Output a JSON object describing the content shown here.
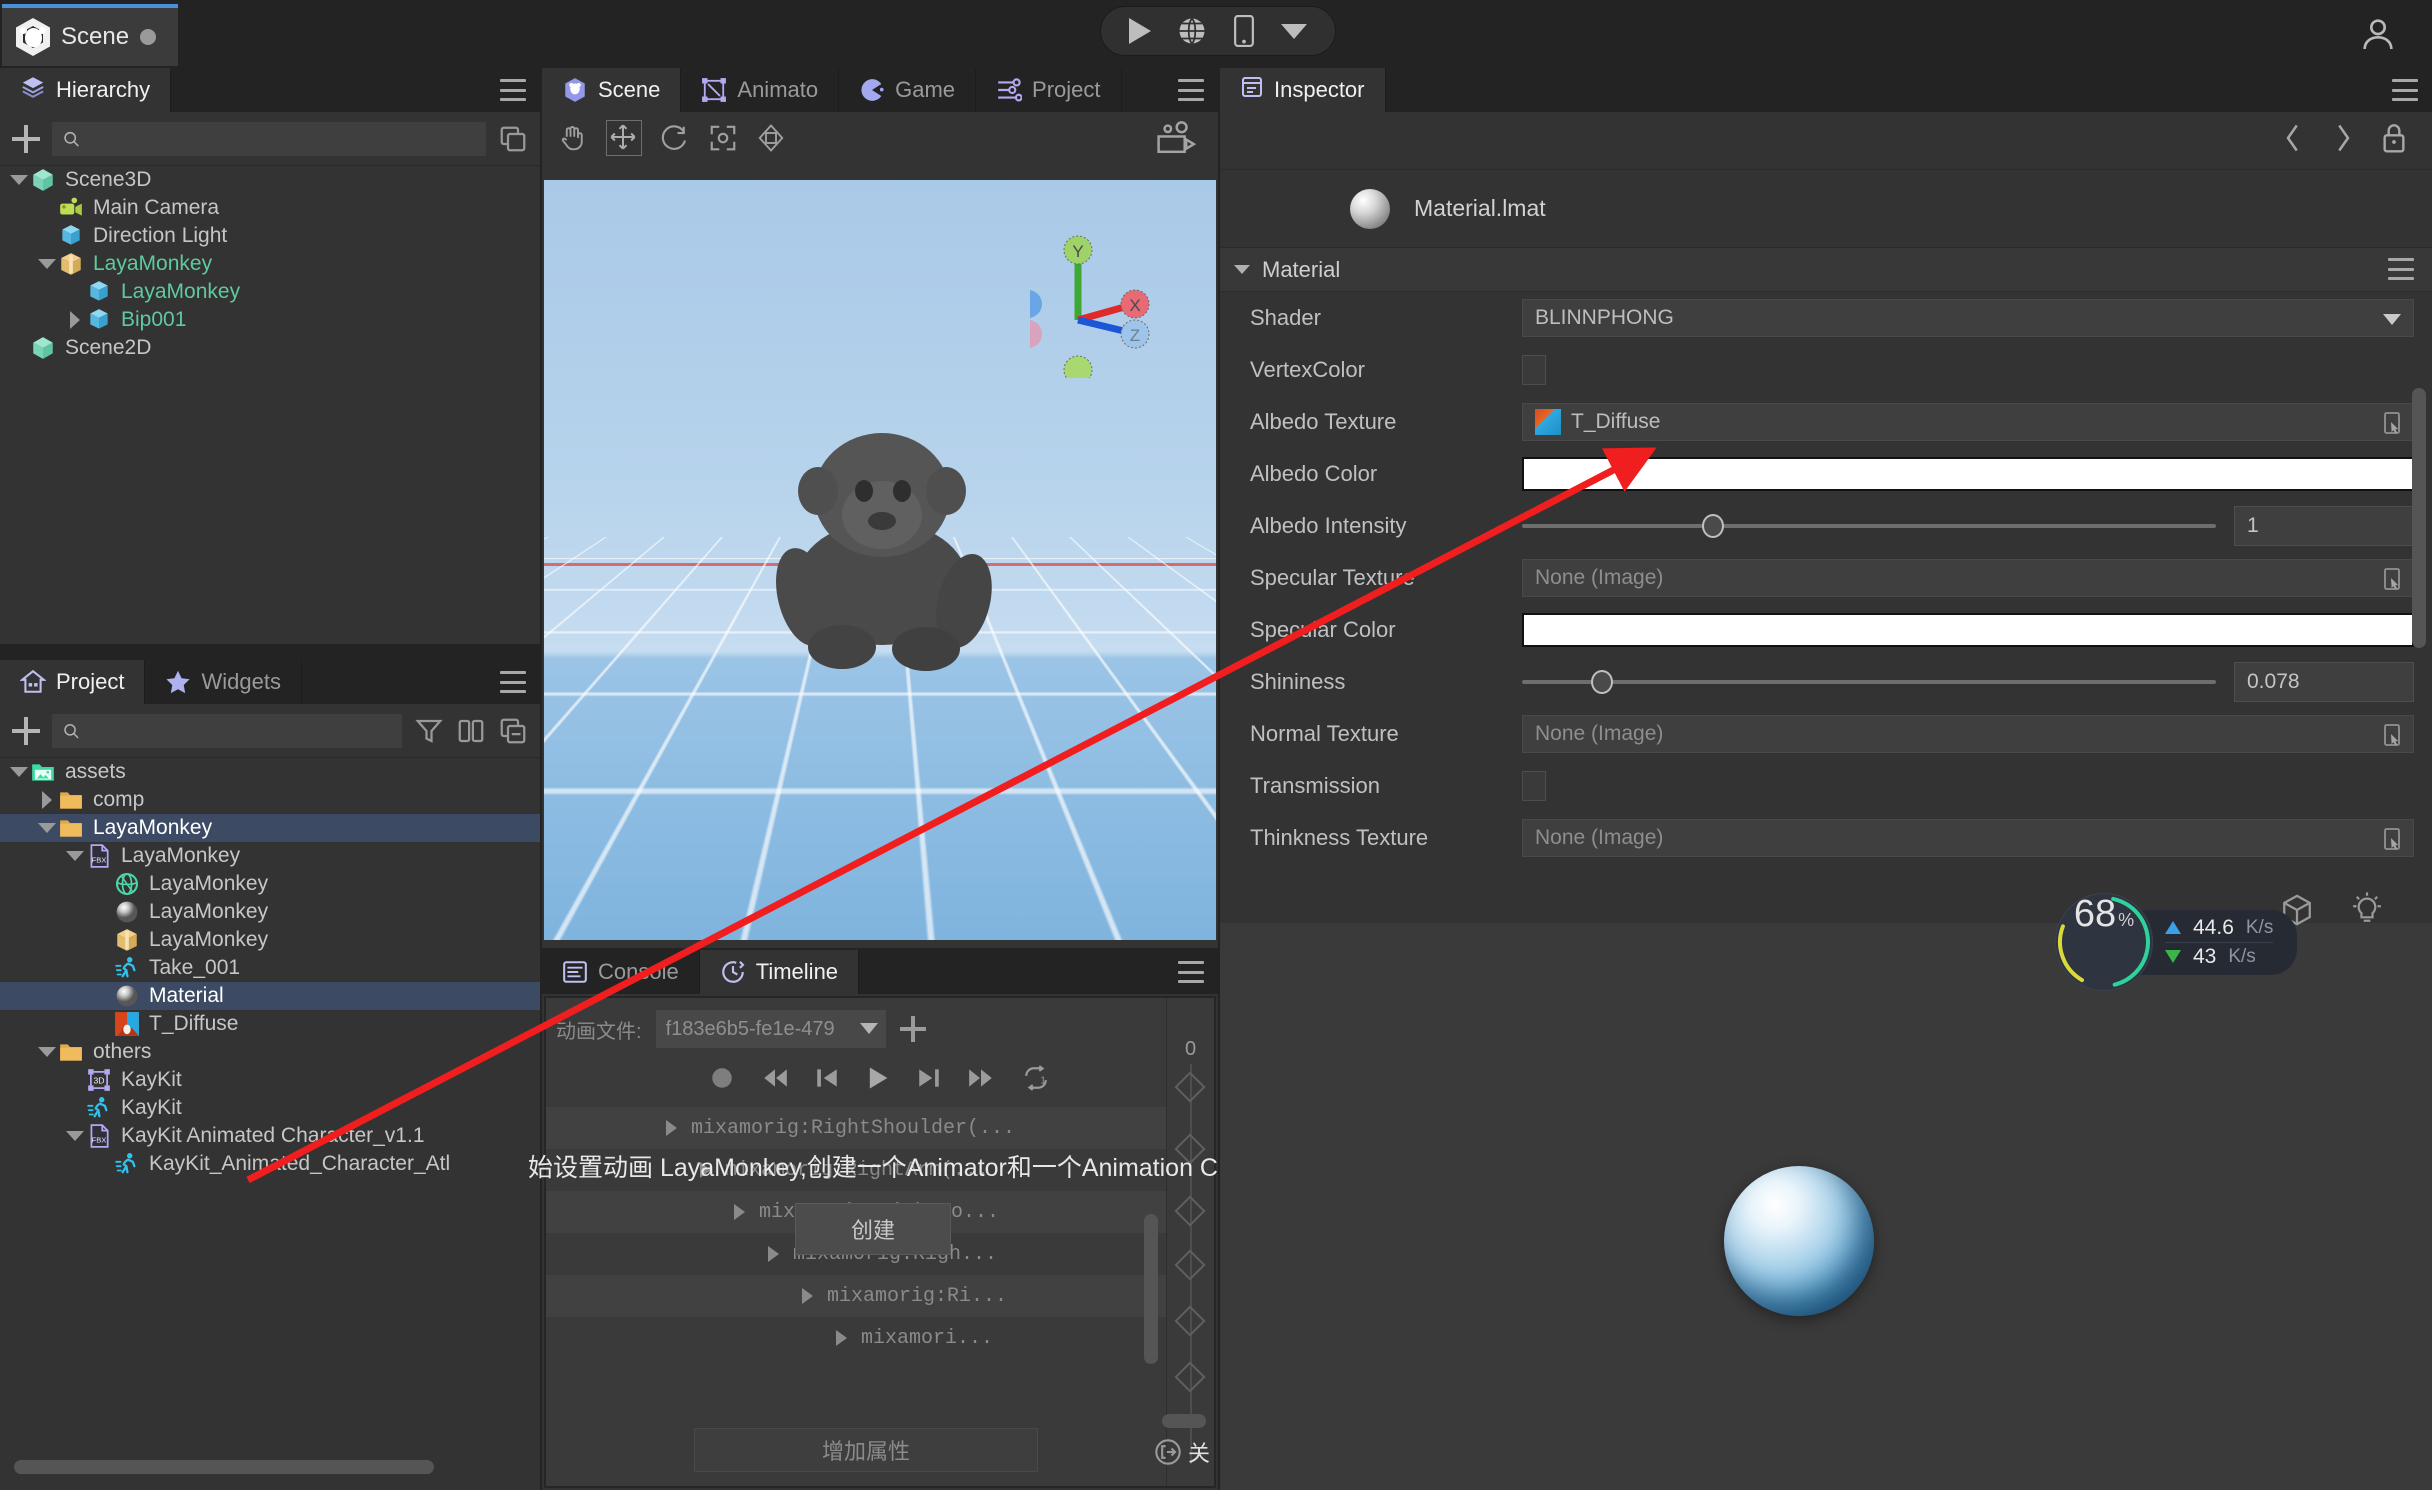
{
  "topbar": {
    "doc_tab_label": "Scene",
    "doc_dirty": true,
    "play_icon": "play-icon",
    "browser_icon": "globe-icon",
    "device_icon": "mobile-icon",
    "dropdown_icon": "chevron-down-icon",
    "account_icon": "user-account-icon"
  },
  "hierarchy": {
    "tab_label": "Hierarchy",
    "menu_icon": "hamburger-menu-icon",
    "add_icon": "plus-icon",
    "search_placeholder": "",
    "search_value": "",
    "clone_icon": "duplicate-icon",
    "items": [
      {
        "label": "Scene3D",
        "indent": 0,
        "twisty": "down",
        "icon": "cube-icon",
        "color": "#c6c6c6",
        "selected": false
      },
      {
        "label": "Main Camera",
        "indent": 1,
        "twisty": "none",
        "icon": "camera-icon",
        "color": "#c6c6c6",
        "selected": false
      },
      {
        "label": "Direction Light",
        "indent": 1,
        "twisty": "none",
        "icon": "light-cube-icon",
        "color": "#c6c6c6",
        "selected": false
      },
      {
        "label": "LayaMonkey",
        "indent": 1,
        "twisty": "down",
        "icon": "prefab-box-icon",
        "color": "#5fc9a0",
        "selected": false
      },
      {
        "label": "LayaMonkey",
        "indent": 2,
        "twisty": "none",
        "icon": "mesh-cube-icon",
        "color": "#5fc9a0",
        "selected": false
      },
      {
        "label": "Bip001",
        "indent": 2,
        "twisty": "right",
        "icon": "mesh-cube-icon",
        "color": "#5fc9a0",
        "selected": false
      },
      {
        "label": "Scene2D",
        "indent": 0,
        "twisty": "none",
        "icon": "cube-icon",
        "color": "#c6c6c6",
        "selected": false
      }
    ]
  },
  "project": {
    "tabs": [
      {
        "label": "Project",
        "icon": "house-icon",
        "active": true
      },
      {
        "label": "Widgets",
        "icon": "star-icon",
        "active": false
      }
    ],
    "menu_icon": "hamburger-menu-icon",
    "add_icon": "plus-icon",
    "search_placeholder": "",
    "search_value": "",
    "filter_icon": "funnel-filter-icon",
    "columns_icon": "split-columns-icon",
    "collapse_icon": "collapse-all-icon",
    "items": [
      {
        "label": "assets",
        "indent": 0,
        "twisty": "down",
        "icon": "assets-folder-icon",
        "selected": false
      },
      {
        "label": "comp",
        "indent": 1,
        "twisty": "right",
        "icon": "folder-icon",
        "selected": false
      },
      {
        "label": "LayaMonkey",
        "indent": 1,
        "twisty": "down",
        "icon": "folder-icon",
        "selected": true
      },
      {
        "label": "LayaMonkey",
        "indent": 2,
        "twisty": "down",
        "icon": "fbx-file-icon",
        "selected": false
      },
      {
        "label": "LayaMonkey",
        "indent": 3,
        "twisty": "none",
        "icon": "mesh-sphere-icon",
        "selected": false
      },
      {
        "label": "LayaMonkey",
        "indent": 3,
        "twisty": "none",
        "icon": "material-ball-icon",
        "selected": false
      },
      {
        "label": "LayaMonkey",
        "indent": 3,
        "twisty": "none",
        "icon": "prefab-box-icon",
        "selected": false
      },
      {
        "label": "Take_001",
        "indent": 3,
        "twisty": "none",
        "icon": "animation-run-icon",
        "selected": false
      },
      {
        "label": "Material",
        "indent": 3,
        "twisty": "none",
        "icon": "material-ball-icon",
        "selected": true
      },
      {
        "label": "T_Diffuse",
        "indent": 3,
        "twisty": "none",
        "icon": "texture-image-icon",
        "selected": false
      },
      {
        "label": "others",
        "indent": 1,
        "twisty": "down",
        "icon": "folder-icon",
        "selected": false
      },
      {
        "label": "KayKit",
        "indent": 2,
        "twisty": "none",
        "icon": "mesh-3d-icon",
        "selected": false
      },
      {
        "label": "KayKit",
        "indent": 2,
        "twisty": "none",
        "icon": "animation-run-icon",
        "selected": false
      },
      {
        "label": "KayKit Animated Character_v1.1",
        "indent": 2,
        "twisty": "down",
        "icon": "fbx-file-icon",
        "selected": false
      },
      {
        "label": "KayKit_Animated_Character_Atl",
        "indent": 3,
        "twisty": "none",
        "icon": "animation-run-icon",
        "selected": false
      }
    ]
  },
  "scene_view": {
    "tabs": [
      {
        "label": "Scene",
        "icon": "laya-scene-icon",
        "active": true
      },
      {
        "label": "Animato",
        "icon": "animator-icon",
        "active": false
      },
      {
        "label": "Game",
        "icon": "game-pacman-icon",
        "active": false
      },
      {
        "label": "Project ",
        "icon": "project-settings-icon",
        "active": false
      }
    ],
    "menu_icon": "hamburger-menu-icon",
    "tools": [
      {
        "name": "hand-pan-tool",
        "active": false
      },
      {
        "name": "move-tool",
        "active": true
      },
      {
        "name": "rotate-tool",
        "active": false
      },
      {
        "name": "scale-tool",
        "active": false
      },
      {
        "name": "global-local-tool",
        "active": false
      }
    ],
    "camera_icon": "scene-camera-icon",
    "gizmo_axes": [
      "Y",
      "X",
      "Z"
    ]
  },
  "inspector": {
    "tab_label": "Inspector",
    "tab_icon": "inspector-icon",
    "menu_icon": "hamburger-menu-icon",
    "nav_back_icon": "chevron-left-icon",
    "nav_forward_icon": "chevron-right-icon",
    "lock_icon": "lock-icon",
    "asset_name": "Material.lmat",
    "asset_icon": "material-ball-icon",
    "section_title": "Material",
    "section_menu_icon": "hamburger-menu-icon",
    "properties": [
      {
        "label": "Shader",
        "type": "dropdown",
        "value": "BLINNPHONG"
      },
      {
        "label": "VertexColor",
        "type": "checkbox",
        "value": false
      },
      {
        "label": "Albedo Texture",
        "type": "texture",
        "value": "T_Diffuse",
        "has_thumb": true
      },
      {
        "label": "Albedo Color",
        "type": "color",
        "value": "#ffffff"
      },
      {
        "label": "Albedo Intensity",
        "type": "slider",
        "value": "1",
        "pct": 26
      },
      {
        "label": "Specular Texture",
        "type": "texture",
        "value": "None (Image)",
        "has_thumb": false
      },
      {
        "label": "Specular Color",
        "type": "color",
        "value": "#ffffff"
      },
      {
        "label": "Shininess",
        "type": "slider",
        "value": "0.078",
        "pct": 10
      },
      {
        "label": "Normal Texture",
        "type": "texture",
        "value": "None (Image)",
        "has_thumb": false
      },
      {
        "label": "Transmission",
        "type": "checkbox",
        "value": false
      },
      {
        "label": "Thinkness Texture",
        "type": "texture",
        "value": "None (Image)",
        "has_thumb": false
      }
    ],
    "preview": {
      "wireframe_icon": "wireframe-cube-icon",
      "light_icon": "light-bulb-icon"
    }
  },
  "stats_hud": {
    "percent": "68",
    "percent_unit": "%",
    "upload": "44.6",
    "upload_unit": "K/s",
    "download": "43",
    "download_unit": "K/s",
    "up_icon": "arrow-up-icon",
    "down_icon": "arrow-down-icon"
  },
  "bottom_panel": {
    "tabs": [
      {
        "label": "Console",
        "icon": "console-icon",
        "active": false
      },
      {
        "label": "Timeline",
        "icon": "timeline-clock-icon",
        "active": true
      }
    ],
    "menu_icon": "hamburger-menu-icon",
    "file_label": "动画文件:",
    "file_value": "f183e6b5-fe1e-479",
    "file_dropdown_icon": "chevron-down-icon",
    "add_icon": "plus-icon",
    "transport": [
      {
        "name": "record-button",
        "icon": "record-dot-icon"
      },
      {
        "name": "jump-start-button",
        "icon": "skip-to-start-icon"
      },
      {
        "name": "prev-frame-button",
        "icon": "step-back-icon"
      },
      {
        "name": "play-button",
        "icon": "play-icon"
      },
      {
        "name": "next-frame-button",
        "icon": "step-forward-icon"
      },
      {
        "name": "jump-end-button",
        "icon": "skip-to-end-icon"
      },
      {
        "name": "loop-button",
        "icon": "loop-once-icon"
      }
    ],
    "ruler_zero": "0",
    "tracks": [
      {
        "label": "mixamorig:RightShoulder(...",
        "indent": 0,
        "alt": true
      },
      {
        "label": "mixamorig:RightArm(...",
        "indent": 1,
        "alt": false
      },
      {
        "label": "mixamorig:RightFo...",
        "indent": 2,
        "alt": true
      },
      {
        "label": "mixamorig:Righ...",
        "indent": 3,
        "alt": false
      },
      {
        "label": "mixamorig:Ri...",
        "indent": 4,
        "alt": true
      },
      {
        "label": "mixamori...",
        "indent": 5,
        "alt": false
      }
    ],
    "add_property_label": "增加属性",
    "close_label": "关",
    "close_icon": "exit-icon"
  },
  "overlay": {
    "tip_text": "始设置动画 LayaMonkey,创建一个Animator和一个Animation C",
    "create_button_label": "创建",
    "arrow_color": "#f01e1e"
  }
}
